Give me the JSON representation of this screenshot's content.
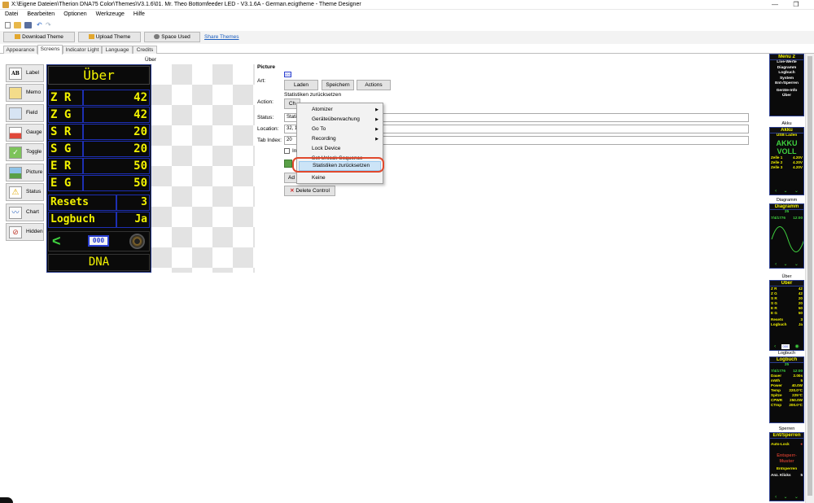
{
  "window": {
    "title": "X:\\Eigene Dateien\\Therion DNA75 Color\\Themes\\V3.1.6\\01. Mr. Theo Bottomfeeder LED - V3.1.6A - German.ecigtheme - Theme Designer",
    "minimize": "—",
    "restore": "❐"
  },
  "menubar": [
    "Datei",
    "Bearbeiten",
    "Optionen",
    "Werkzeuge",
    "Hilfe"
  ],
  "buttons": {
    "download": "Download Theme",
    "upload": "Upload Theme",
    "space": "Space Used",
    "share": "Share Themes"
  },
  "tabs": [
    "Appearance",
    "Screens",
    "Indicator Light",
    "Language",
    "Credits"
  ],
  "active_tab": "Screens",
  "screen_name": "Über",
  "controls": [
    "Label",
    "Memo",
    "Field",
    "Gauge",
    "Toggle",
    "Picture",
    "Status",
    "Chart",
    "Hidden"
  ],
  "preview": {
    "title": "Über",
    "rows": [
      {
        "label": "Z R",
        "value": "42"
      },
      {
        "label": "Z G",
        "value": "42"
      },
      {
        "label": "S R",
        "value": "20"
      },
      {
        "label": "S G",
        "value": "20"
      },
      {
        "label": "E R",
        "value": "50"
      },
      {
        "label": "E G",
        "value": "50"
      }
    ],
    "resets_label": "Resets",
    "resets_value": "3",
    "logbuch_label": "Logbuch",
    "logbuch_value": "Ja",
    "nav_left": "<",
    "nav_mid": "000",
    "footer": "DNA"
  },
  "props": {
    "section": "Picture",
    "art_label": "Art:",
    "art_value": "000",
    "laden": "Laden",
    "speichern": "Speichern",
    "actions": "Actions",
    "action_hint": "Statistiken zurücksetzen",
    "action_label": "Action:",
    "action_btn": "Ch",
    "status_label": "Status:",
    "status_value": "Statisti",
    "location_label": "Location:",
    "location_value": "32, 1",
    "tabindex_label": "Tab Index:",
    "tabindex_value": "20",
    "checkbox_label": "In",
    "add_btn": "Ad",
    "delete_btn": "Delete Control"
  },
  "context_menu": {
    "items": [
      {
        "label": "Atomizer",
        "submenu": true
      },
      {
        "label": "Geräteüberwachung",
        "submenu": true
      },
      {
        "label": "Go To",
        "submenu": true
      },
      {
        "label": "Recording",
        "submenu": true
      },
      {
        "label": "Lock Device",
        "submenu": false
      },
      {
        "label": "Set Unlock Sequence",
        "submenu": false
      },
      {
        "label": "Statistiken zurücksetzen",
        "submenu": false
      },
      {
        "label": "Keine",
        "submenu": false
      }
    ],
    "highlighted": "Statistiken zurücksetzen"
  },
  "right_panels": {
    "menu2": {
      "head": "Menu 2",
      "items": [
        "Live-Werte",
        "Diagramm",
        "Logbuch",
        "System",
        "Ent-/Sperren"
      ],
      "footer1": "Geräte-Info",
      "footer2": "Über"
    },
    "akku": {
      "title": "Akku",
      "head": "Akku",
      "sub": "USB Laden",
      "big1": "AKKU",
      "big2": "VOLL",
      "cells": [
        {
          "k": "Zelle 1",
          "v": "4.20V"
        },
        {
          "k": "Zelle 2",
          "v": "4.20V"
        },
        {
          "k": "Zelle 3",
          "v": "4.20V"
        }
      ]
    },
    "diagramm": {
      "title": "Diagramm",
      "head": "Diagramm",
      "date": "7/4/1776",
      "time": "12:00",
      "count": "25"
    },
    "ueber": {
      "title": "Über",
      "head": "Über",
      "rows": [
        {
          "k": "Z R",
          "v": "42"
        },
        {
          "k": "Z G",
          "v": "42"
        },
        {
          "k": "S R",
          "v": "20"
        },
        {
          "k": "S G",
          "v": "20"
        },
        {
          "k": "E R",
          "v": "50"
        },
        {
          "k": "E G",
          "v": "50"
        },
        {
          "k": "Resets",
          "v": "3"
        },
        {
          "k": "Logbuch",
          "v": "Ja"
        }
      ]
    },
    "logbuch": {
      "title": "Logbuch",
      "head": "Logbuch",
      "date": "7/4/1776",
      "time": "12:00",
      "count": "25",
      "rows": [
        {
          "k": "Dauer",
          "v": "2.00s"
        },
        {
          "k": "mWh",
          "v": "5"
        },
        {
          "k": "Power",
          "v": "40.0W"
        },
        {
          "k": "Temp",
          "v": "220.0°C"
        },
        {
          "k": "Spitze",
          "v": "225°C"
        },
        {
          "k": "CPWR",
          "v": "250.0W"
        },
        {
          "k": "CTmp",
          "v": "200.0°C"
        }
      ]
    },
    "sperren": {
      "title": "Sperren",
      "head": "Ent/Sperren",
      "autolock": "Auto-Lock",
      "muster1": "Entsperr-",
      "muster2": "Muster",
      "entsperren": "Entsperren",
      "klicks_label": "Anz. Klicks",
      "klicks_value": "5"
    }
  },
  "colors": {
    "lcd_yellow": "#f2f200",
    "lcd_border": "#1d2fb3",
    "highlight": "#cce4f7",
    "ring": "#e0492d",
    "nav_green": "#3fd23f"
  }
}
